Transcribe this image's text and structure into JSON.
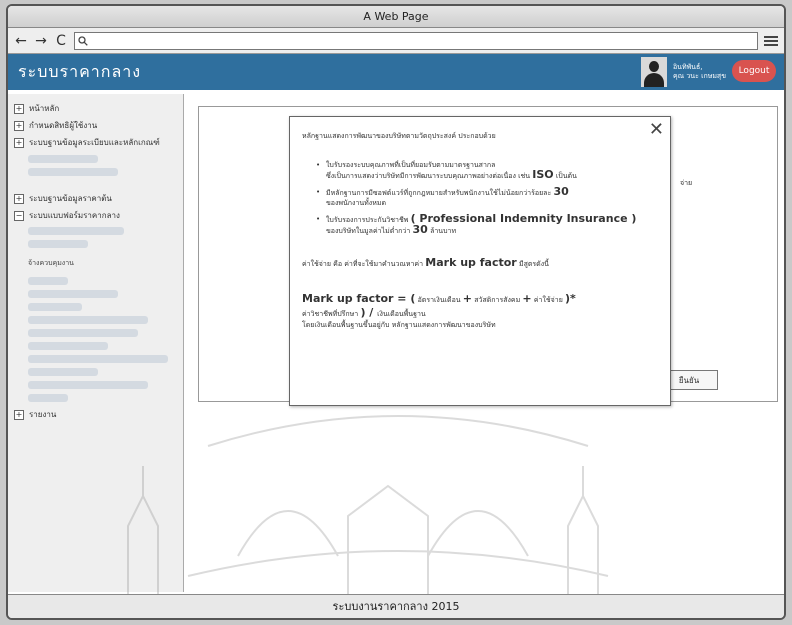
{
  "browser": {
    "title": "A Web Page",
    "url_value": "",
    "nav": {
      "back": "←",
      "forward": "→",
      "reload": "C"
    }
  },
  "app": {
    "title": "ระบบราคากลาง",
    "user_name": "อินทิพันธ์,",
    "user_role": "คุณ วนะ เกษมสุข",
    "logout": "Logout"
  },
  "sidebar": {
    "items": [
      {
        "label": "หน้าหลัก"
      },
      {
        "label": "กำหนดสิทธิผู้ใช้งาน"
      },
      {
        "label": "ระบบฐานข้อมูลระเบียบและหลักเกณฑ์"
      },
      {
        "label": "ระบบฐานข้อมูลราคาต้น"
      },
      {
        "label": "ระบบแบบฟอร์มราคากลาง"
      }
    ],
    "subhead": "จ้างควบคุมงาน",
    "report": "รายงาน"
  },
  "modal": {
    "title": "หลักฐานแสดงการพัฒนาของบริษัทตามวัตถุประสงค์ ประกอบด้วย",
    "bullets": [
      {
        "line1": "ใบรับรองระบบคุณภาพที่เป็นที่ยอมรับตามมาตรฐานสากล",
        "line2_pre": "ซึ่งเป็นการแสดงว่าบริษัทมีการพัฒนาระบบคุณภาพอย่างต่อเนื่อง เช่น",
        "line2_big": "ISO",
        "line2_post": "เป็นต้น"
      },
      {
        "line1_pre": "มีหลักฐานการมีซอฟต์แวร์ที่ถูกกฎหมายสำหรับพนักงานใช้ไม่น้อยกว่าร้อยละ",
        "line1_big": "30",
        "line2": "ของพนักงานทั้งหมด"
      },
      {
        "line1_pre": "ใบรับรองการประกันวิชาชีพ",
        "line1_big": "( Professional Indemnity Insurance )",
        "line2_pre": "ของบริษัทในมูลค่าไม่ต่ำกว่า",
        "line2_big": "30",
        "line2_post": "ล้านบาท"
      }
    ],
    "markup_intro_pre": "ค่าใช้จ่าย คือ ค่าที่จะใช้มาคำนวณหาค่า",
    "markup_intro_big": "Mark up factor",
    "markup_intro_post": "มีสูตรดังนี้",
    "formula_big": "Mark up factor =  (",
    "formula_part1": "อัตราเงินเดือน",
    "formula_plus": "+",
    "formula_part2": "สวัสดิการสังคม",
    "formula_part3": "ค่าใช้จ่าย",
    "formula_close": ")*",
    "formula_line2_pre": "ค่าวิชาชีพที่ปรึกษา",
    "formula_line2_big": ") / ",
    "formula_line2_post": "เงินเดือนพื้นฐาน",
    "formula_line3": "โดยเงินเดือนพื้นฐานขึ้นอยู่กับ หลักฐานแสดงการพัฒนาของบริษัท",
    "close": "✕"
  },
  "content": {
    "side_text": "จ่าย",
    "ok_button": "ยืนยัน"
  },
  "footer": {
    "text_th": "ระบบงานราคากลาง",
    "year": "2015"
  }
}
